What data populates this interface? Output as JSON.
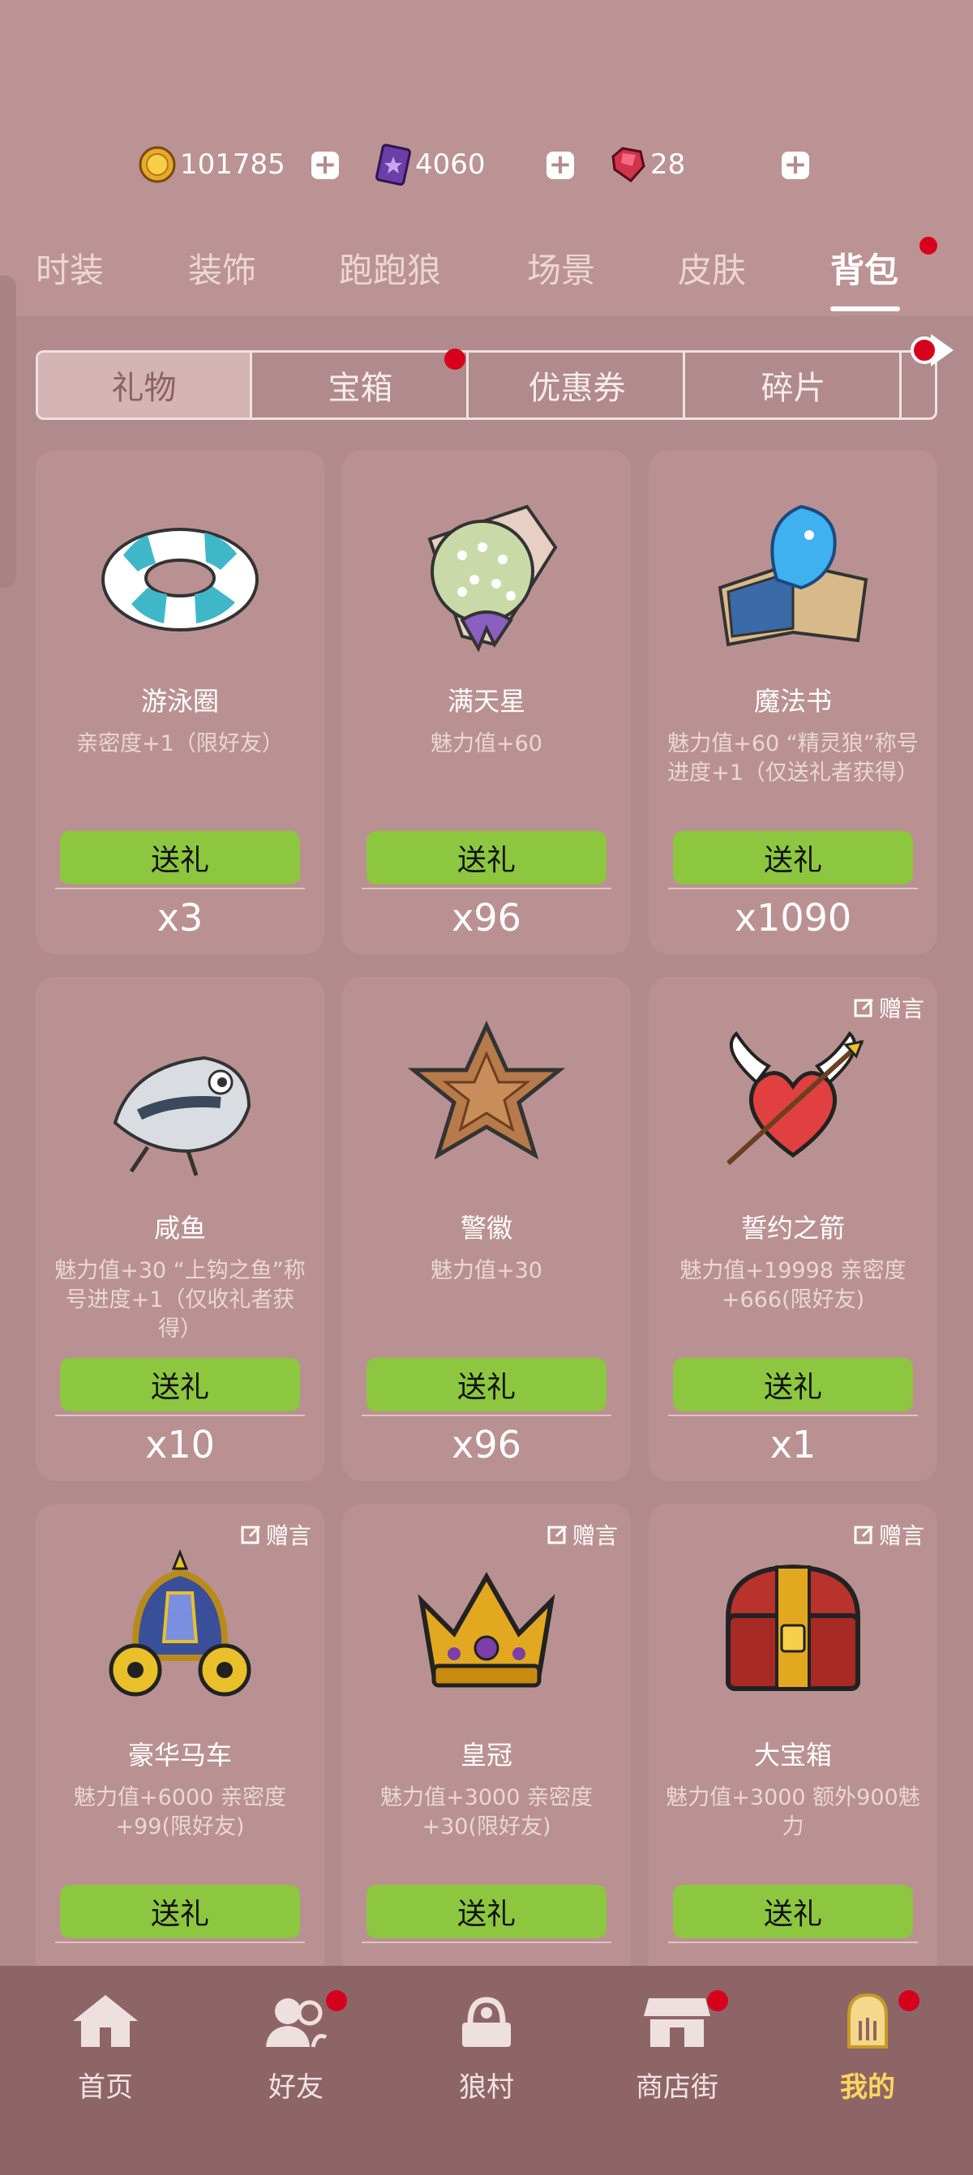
{
  "currencies": [
    {
      "icon": "coin-icon",
      "value": "101785"
    },
    {
      "icon": "purple-card-icon",
      "value": "4060"
    },
    {
      "icon": "ruby-gem-icon",
      "value": "28"
    }
  ],
  "tabs": [
    "时装",
    "装饰",
    "跑跑狼",
    "场景",
    "皮肤",
    "背包"
  ],
  "subtabs": [
    "礼物",
    "宝箱",
    "优惠券",
    "碎片"
  ],
  "note_label": "赠言",
  "send_label": "送礼",
  "items": [
    {
      "name": "游泳圈",
      "desc": "亲密度+1（限好友）",
      "count": "x3",
      "icon": "swim-ring-icon"
    },
    {
      "name": "满天星",
      "desc": "魅力值+60",
      "count": "x96",
      "icon": "flower-bouquet-icon"
    },
    {
      "name": "魔法书",
      "desc": "魅力值+60 “精灵狼”称号进度+1（仅送礼者获得）",
      "count": "x1090",
      "icon": "magic-book-icon"
    },
    {
      "name": "咸鱼",
      "desc": "魅力值+30 “上钩之鱼”称号进度+1（仅收礼者获得）",
      "count": "x10",
      "icon": "salted-fish-icon"
    },
    {
      "name": "警徽",
      "desc": "魅力值+30",
      "count": "x96",
      "icon": "police-badge-icon"
    },
    {
      "name": "誓约之箭",
      "desc": "魅力值+19998 亲密度+666(限好友)",
      "count": "x1",
      "icon": "cupid-arrow-icon"
    },
    {
      "name": "豪华马车",
      "desc": "魅力值+6000 亲密度+99(限好友)",
      "count": "",
      "icon": "carriage-icon"
    },
    {
      "name": "皇冠",
      "desc": "魅力值+3000 亲密度+30(限好友)",
      "count": "",
      "icon": "crown-icon"
    },
    {
      "name": "大宝箱",
      "desc": "魅力值+3000 额外900魅力",
      "count": "",
      "icon": "treasure-chest-icon"
    }
  ],
  "nav": [
    {
      "label": "首页",
      "icon": "home-icon"
    },
    {
      "label": "好友",
      "icon": "friends-icon"
    },
    {
      "label": "狼村",
      "icon": "village-icon"
    },
    {
      "label": "商店街",
      "icon": "shop-icon"
    },
    {
      "label": "我的",
      "icon": "profile-icon"
    }
  ],
  "colors": {
    "accent_green": "#8dc63f",
    "badge_red": "#d6001c",
    "active_gold": "#ffd65c"
  }
}
